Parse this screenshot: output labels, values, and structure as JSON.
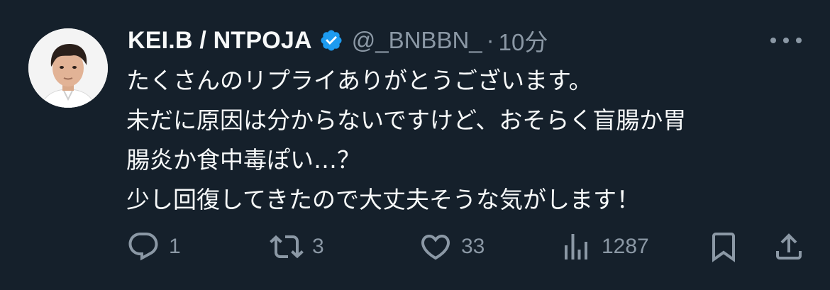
{
  "author": {
    "display_name": "KEI.B / NTPOJA",
    "handle": "@_BNBBN_",
    "separator": "·",
    "time": "10分",
    "verified": true
  },
  "tweet": {
    "lines": [
      "たくさんのリプライありがとうございます。",
      "未だに原因は分からないですけど、おそらく盲腸か胃",
      "腸炎か食中毒ぽい…？",
      "少し回復してきたので大丈夫そうな気がします！"
    ]
  },
  "actions": {
    "reply": {
      "icon": "reply-icon",
      "count": "1"
    },
    "retweet": {
      "icon": "retweet-icon",
      "count": "3"
    },
    "like": {
      "icon": "heart-icon",
      "count": "33"
    },
    "views": {
      "icon": "views-icon",
      "count": "1287"
    },
    "bookmark": {
      "icon": "bookmark-icon"
    },
    "share": {
      "icon": "share-icon"
    }
  },
  "colors": {
    "background": "#15202b",
    "text": "#f7f9f9",
    "muted": "#8b98a5",
    "verified": "#1d9bf0"
  }
}
